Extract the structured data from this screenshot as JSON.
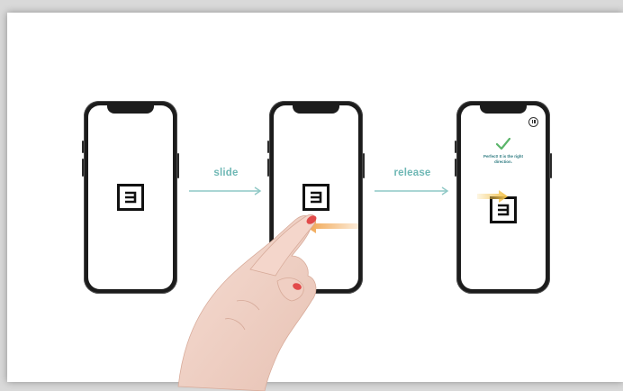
{
  "steps": [
    {
      "label": "slide"
    },
    {
      "label": "release"
    }
  ],
  "result": {
    "message_line1": "Perfect! It is the right",
    "message_line2": "direction.",
    "icon": "checkmark-icon"
  },
  "colors": {
    "accent_teal": "#6fb8b5",
    "check_green": "#5bb56a",
    "arrow_orange": "#f0a24a"
  }
}
